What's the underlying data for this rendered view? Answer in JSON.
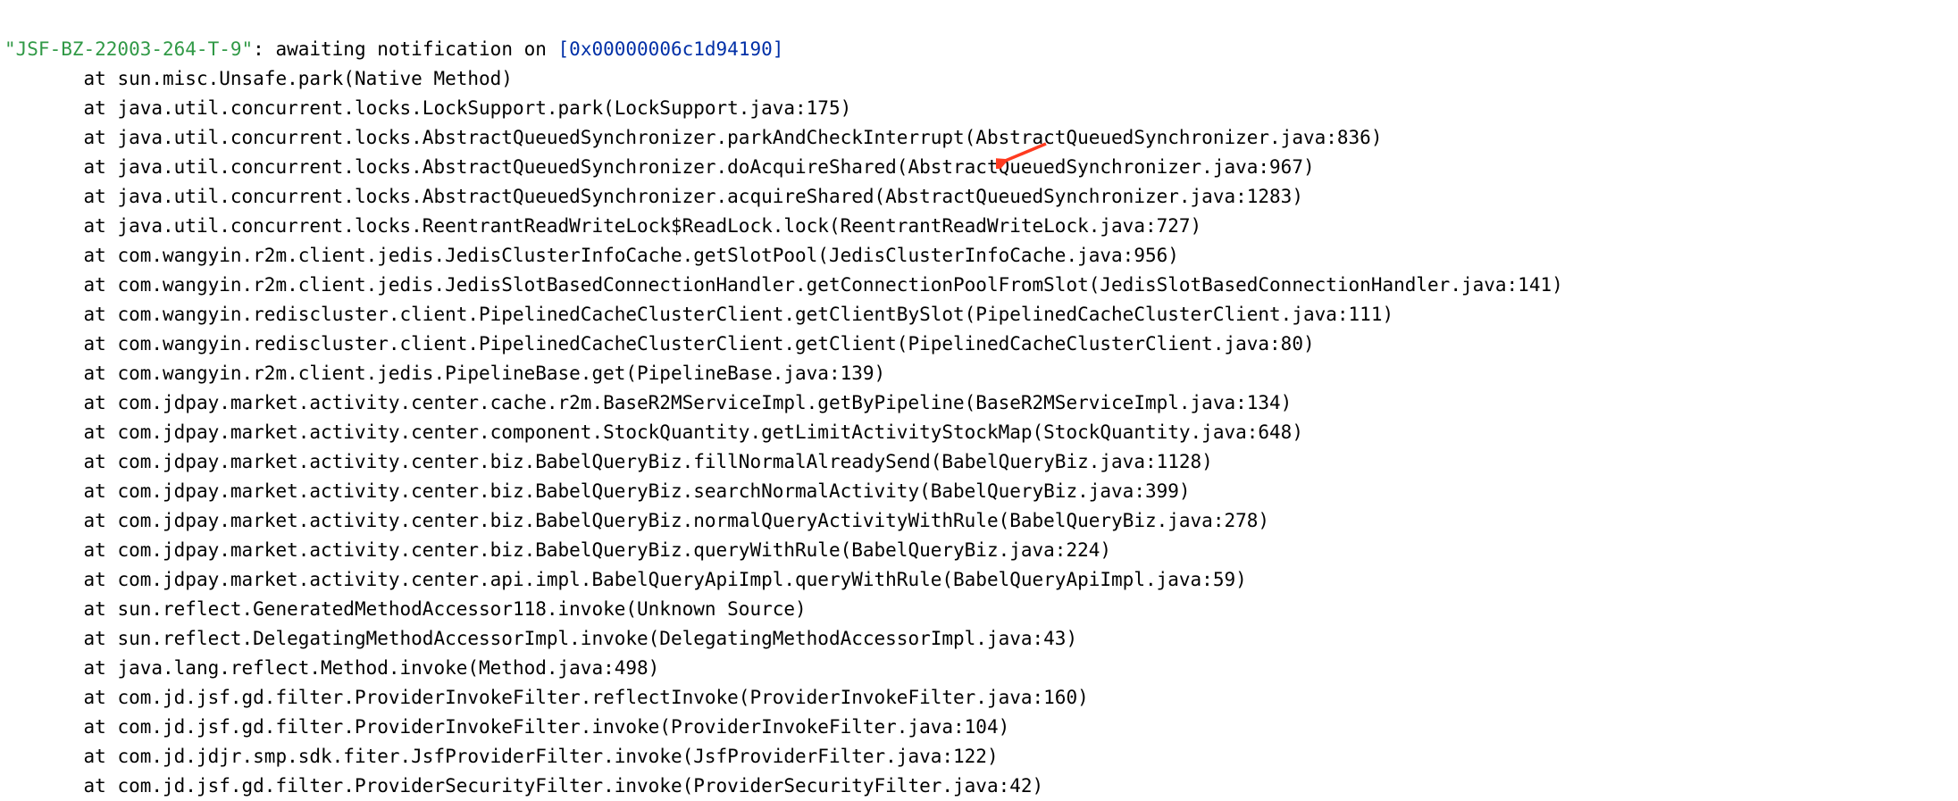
{
  "header": {
    "thread_name": "\"JSF-BZ-22003-264-T-9\"",
    "sep": ": ",
    "status": "awaiting notification on ",
    "addr": "[0x00000006c1d94190]"
  },
  "frames": [
    "sun.misc.Unsafe.park(Native Method)",
    "java.util.concurrent.locks.LockSupport.park(LockSupport.java:175)",
    "java.util.concurrent.locks.AbstractQueuedSynchronizer.parkAndCheckInterrupt(AbstractQueuedSynchronizer.java:836)",
    "java.util.concurrent.locks.AbstractQueuedSynchronizer.doAcquireShared(AbstractQueuedSynchronizer.java:967)",
    "java.util.concurrent.locks.AbstractQueuedSynchronizer.acquireShared(AbstractQueuedSynchronizer.java:1283)",
    "java.util.concurrent.locks.ReentrantReadWriteLock$ReadLock.lock(ReentrantReadWriteLock.java:727)",
    "com.wangyin.r2m.client.jedis.JedisClusterInfoCache.getSlotPool(JedisClusterInfoCache.java:956)",
    "com.wangyin.r2m.client.jedis.JedisSlotBasedConnectionHandler.getConnectionPoolFromSlot(JedisSlotBasedConnectionHandler.java:141)",
    "com.wangyin.rediscluster.client.PipelinedCacheClusterClient.getClientBySlot(PipelinedCacheClusterClient.java:111)",
    "com.wangyin.rediscluster.client.PipelinedCacheClusterClient.getClient(PipelinedCacheClusterClient.java:80)",
    "com.wangyin.r2m.client.jedis.PipelineBase.get(PipelineBase.java:139)",
    "com.jdpay.market.activity.center.cache.r2m.BaseR2MServiceImpl.getByPipeline(BaseR2MServiceImpl.java:134)",
    "com.jdpay.market.activity.center.component.StockQuantity.getLimitActivityStockMap(StockQuantity.java:648)",
    "com.jdpay.market.activity.center.biz.BabelQueryBiz.fillNormalAlreadySend(BabelQueryBiz.java:1128)",
    "com.jdpay.market.activity.center.biz.BabelQueryBiz.searchNormalActivity(BabelQueryBiz.java:399)",
    "com.jdpay.market.activity.center.biz.BabelQueryBiz.normalQueryActivityWithRule(BabelQueryBiz.java:278)",
    "com.jdpay.market.activity.center.biz.BabelQueryBiz.queryWithRule(BabelQueryBiz.java:224)",
    "com.jdpay.market.activity.center.api.impl.BabelQueryApiImpl.queryWithRule(BabelQueryApiImpl.java:59)",
    "sun.reflect.GeneratedMethodAccessor118.invoke(Unknown Source)",
    "sun.reflect.DelegatingMethodAccessorImpl.invoke(DelegatingMethodAccessorImpl.java:43)",
    "java.lang.reflect.Method.invoke(Method.java:498)",
    "com.jd.jsf.gd.filter.ProviderInvokeFilter.reflectInvoke(ProviderInvokeFilter.java:160)",
    "com.jd.jsf.gd.filter.ProviderInvokeFilter.invoke(ProviderInvokeFilter.java:104)",
    "com.jd.jdjr.smp.sdk.fiter.JsfProviderFilter.invoke(JsfProviderFilter.java:122)",
    "com.jd.jsf.gd.filter.ProviderSecurityFilter.invoke(ProviderSecurityFilter.java:42)"
  ],
  "arrow": {
    "color": "#ff3b20"
  }
}
